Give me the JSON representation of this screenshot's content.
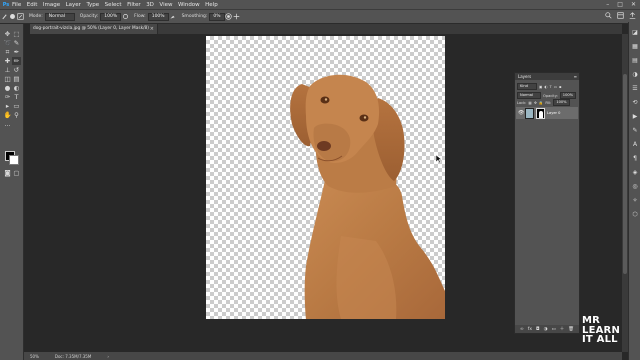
{
  "app": {
    "logo": "Ps"
  },
  "menu": [
    "File",
    "Edit",
    "Image",
    "Layer",
    "Type",
    "Select",
    "Filter",
    "3D",
    "View",
    "Window",
    "Help"
  ],
  "window_controls": [
    "–",
    "□",
    "✕"
  ],
  "options_bar": {
    "mode_label": "Mode:",
    "mode_value": "Normal",
    "opacity_label": "Opacity:",
    "opacity_value": "100%",
    "flow_label": "Flow:",
    "flow_value": "100%",
    "smoothing_label": "Smoothing:",
    "smoothing_value": "0%"
  },
  "document_tab": {
    "title": "dog-portrait-vizsla.jpg @ 50% (Layer 0, Layer Mask/8)",
    "close": "×"
  },
  "colors": {
    "foreground": "#000000",
    "background": "#ffffff"
  },
  "status_bar": {
    "zoom": "50%",
    "doc_info": "Doc: 7.35M/7.35M"
  },
  "layers_panel": {
    "title": "Layers",
    "kind_value": "Kind",
    "blend_mode": "Normal",
    "opacity_label": "Opacity:",
    "opacity_value": "100%",
    "lock_label": "Lock:",
    "fill_label": "Fill:",
    "fill_value": "100%",
    "layers": [
      {
        "name": "Layer 0",
        "visible": true
      }
    ]
  },
  "watermark": {
    "line1": "MR",
    "line2": "LEARN",
    "line3": "IT ALL"
  }
}
